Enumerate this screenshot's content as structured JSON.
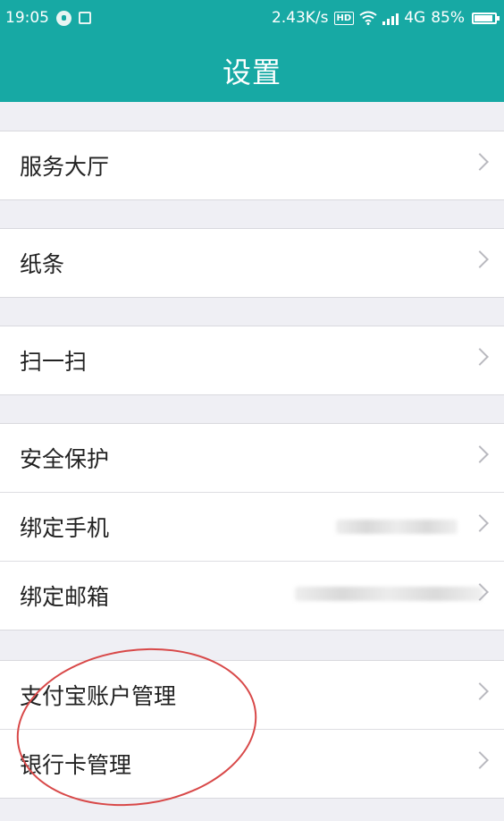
{
  "status_bar": {
    "time": "19:05",
    "network_speed": "2.43K/s",
    "hd_label": "HD",
    "network_type": "4G",
    "battery_percent": "85%",
    "battery_level": 0.85
  },
  "header": {
    "title": "设置"
  },
  "groups": [
    {
      "items": [
        {
          "label": "服务大厅"
        }
      ]
    },
    {
      "items": [
        {
          "label": "纸条"
        }
      ]
    },
    {
      "items": [
        {
          "label": "扫一扫"
        }
      ]
    },
    {
      "items": [
        {
          "label": "安全保护"
        },
        {
          "label": "绑定手机"
        },
        {
          "label": "绑定邮箱"
        }
      ]
    },
    {
      "items": [
        {
          "label": "支付宝账户管理"
        },
        {
          "label": "银行卡管理"
        }
      ]
    }
  ],
  "colors": {
    "accent": "#17a9a4",
    "background": "#efeff4",
    "annotation_circle": "#d84848"
  }
}
